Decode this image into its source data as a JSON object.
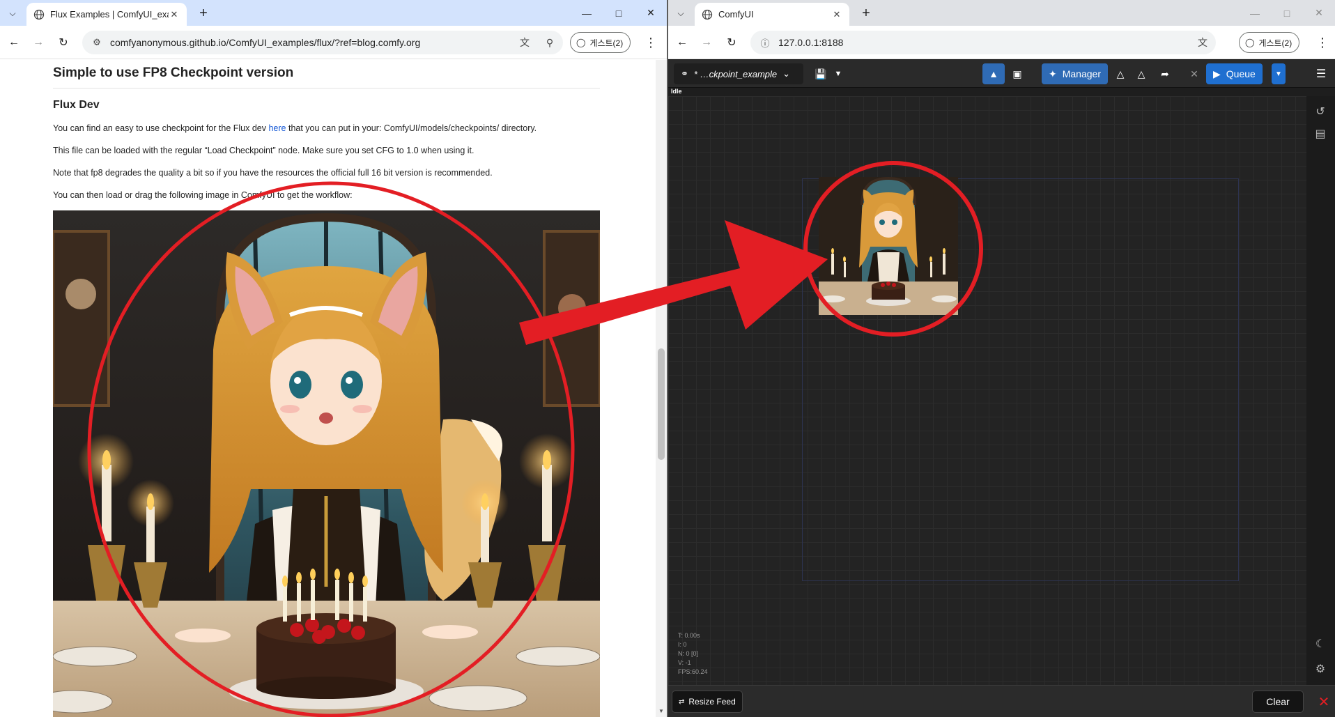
{
  "left_browser": {
    "tab_title": "Flux Examples | ComfyUI_exam",
    "url": "comfyanonymous.github.io/ComfyUI_examples/flux/?ref=blog.comfy.org",
    "profile_label": "게스트(2)",
    "icons": [
      "tab-dropdown-icon",
      "close-icon",
      "plus-icon",
      "minimize-icon",
      "maximize-icon",
      "back-icon",
      "forward-icon",
      "reload-icon",
      "site-info-icon",
      "translate-icon",
      "zoom-icon",
      "profile-icon",
      "kebab-icon"
    ]
  },
  "page": {
    "heading": "Simple to use FP8 Checkpoint version",
    "subheading": "Flux Dev",
    "para1_before": "You can find an easy to use checkpoint for the Flux dev ",
    "para1_link": "here",
    "para1_after": " that you can put in your: ComfyUI/models/checkpoints/ directory.",
    "para2": "This file can be loaded with the regular “Load Checkpoint” node. Make sure you set CFG to 1.0 when using it.",
    "para3": "Note that fp8 degrades the quality a bit so if you have the resources the official full 16 bit version is recommended.",
    "para4": "You can then load or drag the following image in ComfyUI to get the workflow:"
  },
  "right_browser": {
    "tab_title": "ComfyUI",
    "url": "127.0.0.1:8188",
    "profile_label": "게스트(2)"
  },
  "comfy": {
    "workflow_name": "* …ckpoint_example",
    "manager_label": "Manager",
    "queue_label": "Queue",
    "status": "Idle",
    "stats": [
      "T: 0.00s",
      "I: 0",
      "N: 0 [0]",
      "V: -1",
      "FPS:60.24"
    ],
    "resize_feed_label": "Resize Feed",
    "clear_label": "Clear"
  },
  "colors": {
    "annotation_red": "#e31e24",
    "link_blue": "#1558d6",
    "comfy_accent": "#2f6bb5"
  }
}
